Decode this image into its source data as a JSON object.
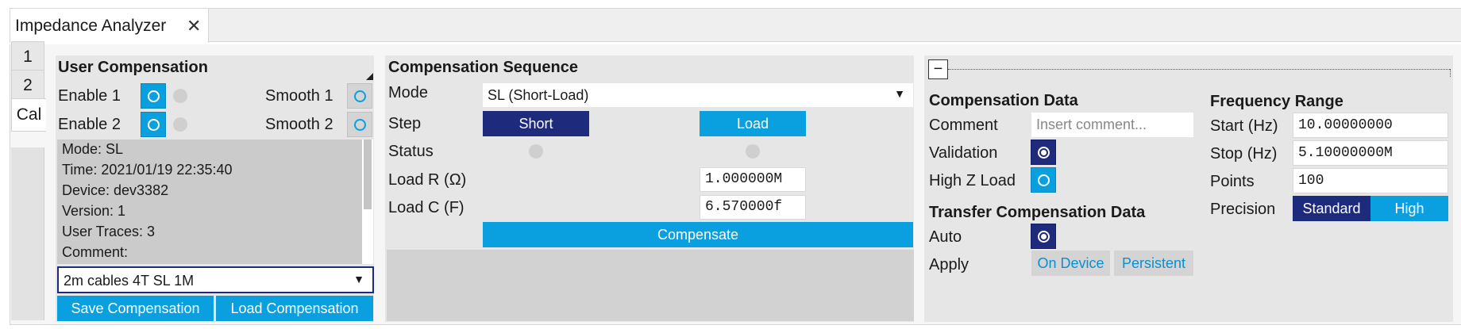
{
  "window": {
    "tab_title": "Impedance Analyzer",
    "close_glyph": "✕"
  },
  "vtabs": [
    "1",
    "2",
    "Cal"
  ],
  "user_comp": {
    "title": "User Compensation",
    "enable1": "Enable 1",
    "enable2": "Enable 2",
    "smooth1": "Smooth 1",
    "smooth2": "Smooth 2",
    "info": {
      "mode": "Mode: SL",
      "time": "Time: 2021/01/19 22:35:40",
      "device": "Device: dev3382",
      "version": "Version: 1",
      "traces": "User Traces: 3",
      "comment": "Comment:"
    },
    "file_select": "2m cables 4T SL 1M",
    "save_label": "Save Compensation",
    "load_label": "Load Compensation"
  },
  "sequence": {
    "title": "Compensation Sequence",
    "mode_label": "Mode",
    "mode_value": "SL (Short-Load)",
    "step_label": "Step",
    "status_label": "Status",
    "short_label": "Short",
    "load_label": "Load",
    "loadr_label": "Load R (Ω)",
    "loadr_value": "1.000000M",
    "loadc_label": "Load C (F)",
    "loadc_value": "6.570000f",
    "compensate_label": "Compensate"
  },
  "comp_data": {
    "collapse_glyph": "−",
    "title": "Compensation Data",
    "comment_label": "Comment",
    "comment_placeholder": "Insert comment...",
    "validation_label": "Validation",
    "highz_label": "High Z Load"
  },
  "transfer": {
    "title": "Transfer Compensation Data",
    "auto_label": "Auto",
    "apply_label": "Apply",
    "on_device_label": "On Device",
    "persistent_label": "Persistent"
  },
  "freq": {
    "title": "Frequency Range",
    "start_label": "Start (Hz)",
    "start_value": "10.00000000",
    "stop_label": "Stop (Hz)",
    "stop_value": "5.10000000M",
    "points_label": "Points",
    "points_value": "100",
    "precision_label": "Precision",
    "standard_label": "Standard",
    "high_label": "High"
  },
  "colors": {
    "accent": "#0aa0e0",
    "accent_dark": "#1e2b7d",
    "panel": "#e6e6e6",
    "info_bg": "#cbcbcb"
  }
}
